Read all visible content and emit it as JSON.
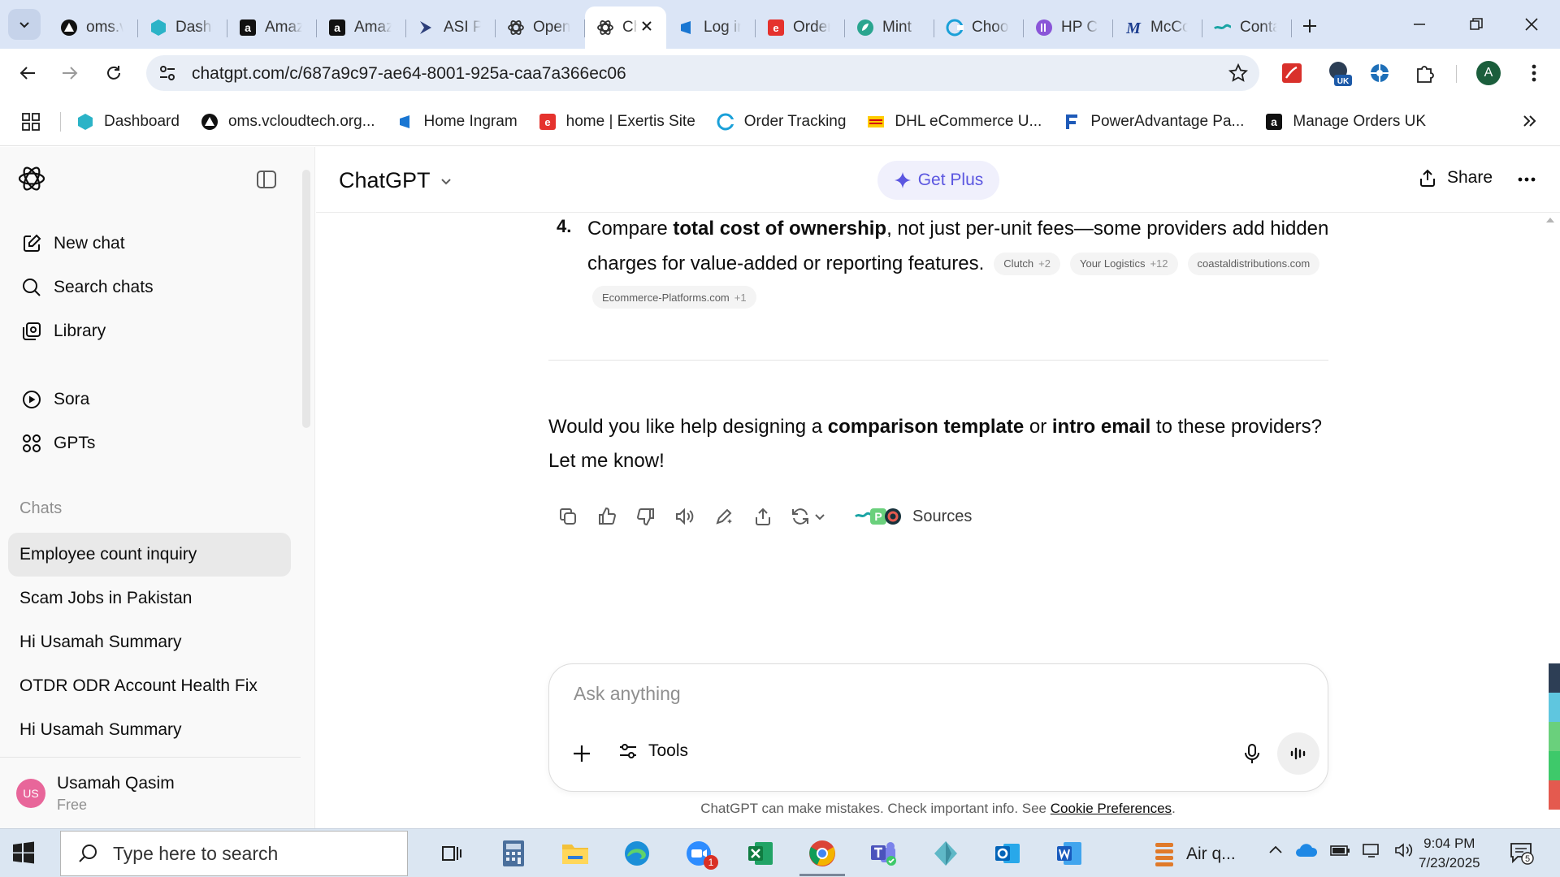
{
  "browser": {
    "tabs": [
      {
        "title": "oms.vcloudtech.org",
        "icon": "triangle-icon",
        "color": "#111111"
      },
      {
        "title": "Dashboard",
        "icon": "hexagon-icon",
        "color": "#2bb3c7"
      },
      {
        "title": "Amazon",
        "icon": "amazon-icon",
        "color": "#111111"
      },
      {
        "title": "Amazon",
        "icon": "amazon-icon",
        "color": "#111111"
      },
      {
        "title": "ASI Portal",
        "icon": "arrow-icon",
        "color": "#2c3e7a"
      },
      {
        "title": "OpenAI",
        "icon": "openai-icon",
        "color": "#333333"
      },
      {
        "title": "ChatGPT",
        "icon": "openai-icon",
        "color": "#333333",
        "active": true
      },
      {
        "title": "Log in",
        "icon": "ingram-icon",
        "color": "#1976d2"
      },
      {
        "title": "Orders",
        "icon": "exertis-icon",
        "color": "#e5322d"
      },
      {
        "title": "Mint",
        "icon": "mint-icon",
        "color": "#2aa58f"
      },
      {
        "title": "Choose",
        "icon": "c-icon",
        "color": "#1aa0d8"
      },
      {
        "title": "HP Com",
        "icon": "hp-icon",
        "color": "#8a55d8"
      },
      {
        "title": "McCormick",
        "icon": "m-icon",
        "color": "#1c3d8f"
      },
      {
        "title": "Contact",
        "icon": "wave-icon",
        "color": "#1aa4a4"
      }
    ],
    "address": "chatgpt.com/c/687a9c97-ae64-8001-925a-caa7a366ec06",
    "profile_initial": "A",
    "uk_badge": "UK",
    "bookmarks": [
      {
        "label": "Dashboard",
        "icon": "hexagon-icon",
        "color": "#2bb3c7"
      },
      {
        "label": "oms.vcloudtech.org...",
        "icon": "triangle-icon",
        "color": "#111111"
      },
      {
        "label": "Home Ingram",
        "icon": "ingram-icon",
        "color": "#1976d2"
      },
      {
        "label": "home | Exertis Site",
        "icon": "exertis-icon",
        "color": "#e5322d"
      },
      {
        "label": "Order Tracking",
        "icon": "c-icon",
        "color": "#1aa0d8"
      },
      {
        "label": "DHL eCommerce U...",
        "icon": "dhl-icon",
        "color": "#ffcc00"
      },
      {
        "label": "PowerAdvantage Pa...",
        "icon": "f-icon",
        "color": "#1e5ab8"
      },
      {
        "label": "Manage Orders UK",
        "icon": "amazon-icon",
        "color": "#111111"
      }
    ]
  },
  "sidebar": {
    "nav": [
      {
        "label": "New chat",
        "icon": "edit-icon"
      },
      {
        "label": "Search chats",
        "icon": "search-icon"
      },
      {
        "label": "Library",
        "icon": "library-icon"
      },
      {
        "label": "Sora",
        "icon": "play-icon"
      },
      {
        "label": "GPTs",
        "icon": "grid-icon"
      }
    ],
    "chats_label": "Chats",
    "chats": [
      {
        "title": "Employee count inquiry",
        "selected": true
      },
      {
        "title": "Scam Jobs in Pakistan"
      },
      {
        "title": "Hi Usamah Summary"
      },
      {
        "title": "OTDR ODR Account Health Fix"
      },
      {
        "title": "Hi Usamah Summary"
      }
    ],
    "user": {
      "initials": "US",
      "name": "Usamah Qasim",
      "plan": "Free"
    }
  },
  "header": {
    "model": "ChatGPT",
    "get_plus": "Get Plus",
    "share": "Share"
  },
  "message": {
    "point_number": "4.",
    "point_pre": "Compare ",
    "point_bold": "total cost of ownership",
    "point_post": ", not just per-unit fees—some providers add hidden",
    "point_line2": "charges for value-added or reporting features.",
    "citations": [
      {
        "name": "Clutch",
        "count": "+2"
      },
      {
        "name": "Your Logistics",
        "count": "+12"
      },
      {
        "name": "coastaldistributions.com",
        "count": ""
      },
      {
        "name": "Ecommerce-Platforms.com",
        "count": "+1"
      }
    ],
    "closing": {
      "p1": "Would you like help designing a ",
      "b1": "comparison template",
      "p2": " or ",
      "b2": "intro email",
      "p3": " to these providers?",
      "line2": "Let me know!"
    },
    "sources_label": "Sources"
  },
  "composer": {
    "placeholder": "Ask anything",
    "tools": "Tools"
  },
  "disclaimer": {
    "text": "ChatGPT can make mistakes. Check important info. See ",
    "link": "Cookie Preferences",
    "end": "."
  },
  "taskbar": {
    "search_placeholder": "Type here to search",
    "apps": [
      "task-view",
      "calculator",
      "file-explorer",
      "edge",
      "zoom",
      "excel",
      "chrome",
      "teams",
      "app-diamond",
      "outlook",
      "word"
    ],
    "zoom_badge": "1",
    "weather": "Air q...",
    "time": "9:04 PM",
    "date": "7/23/2025",
    "notifications": "5"
  },
  "colors": {
    "accent": "#5b56e0",
    "tab_strip": "#dbe5f6",
    "sidebar_bg": "#f9f9f9",
    "selected_chat": "#e9e9e9"
  }
}
